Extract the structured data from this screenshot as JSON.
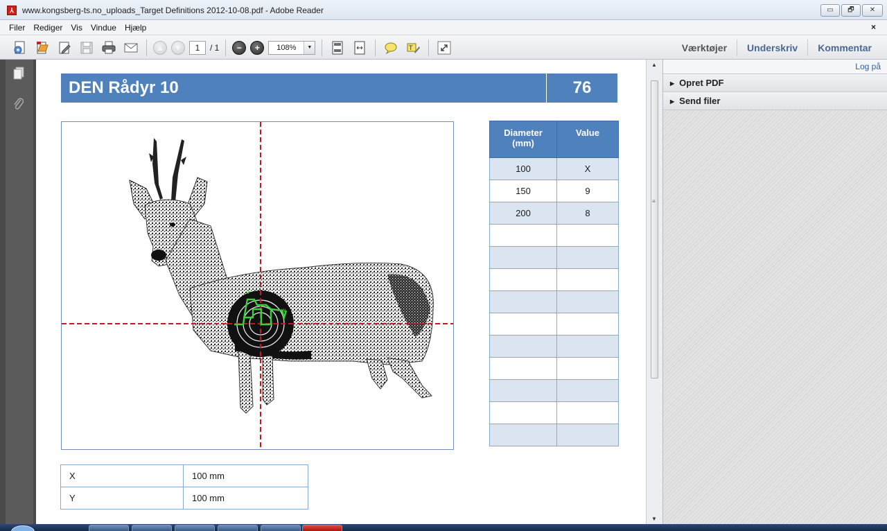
{
  "window": {
    "title": "www.kongsberg-ts.no_uploads_Target Definitions 2012-10-08.pdf - Adobe Reader",
    "buttons": [
      "▭",
      "🗗",
      "✕"
    ]
  },
  "menu": {
    "items": [
      "Filer",
      "Rediger",
      "Vis",
      "Vindue",
      "Hjælp"
    ],
    "close_doc": "×"
  },
  "toolbar": {
    "page_current": "1",
    "page_total": "/ 1",
    "zoom": "108%",
    "zoom_dropdown": "▼",
    "zoom_out": "−",
    "zoom_in": "+",
    "right_links": [
      "Værktøjer",
      "Underskriv",
      "Kommentar"
    ]
  },
  "document": {
    "title": "DEN Rådyr 10",
    "number": "76",
    "value_table": {
      "headers": [
        "Diameter (mm)",
        "Value"
      ],
      "rows": [
        [
          "100",
          "X"
        ],
        [
          "150",
          "9"
        ],
        [
          "200",
          "8"
        ],
        [
          "",
          ""
        ],
        [
          "",
          ""
        ],
        [
          "",
          ""
        ],
        [
          "",
          ""
        ],
        [
          "",
          ""
        ],
        [
          "",
          ""
        ],
        [
          "",
          ""
        ],
        [
          "",
          ""
        ],
        [
          "",
          ""
        ],
        [
          "",
          ""
        ]
      ]
    },
    "xy_table": [
      [
        "X",
        "100 mm"
      ],
      [
        "Y",
        "100 mm"
      ]
    ],
    "target": {
      "diameters_mm": [
        100,
        150,
        200
      ],
      "bullseye_color": "#111111",
      "crosshair_color": "#c0191f",
      "marker_color": "#38d13a"
    }
  },
  "rightpane": {
    "login": "Log på",
    "sections": [
      "Opret PDF",
      "Send filer"
    ]
  },
  "colors": {
    "banner": "#4f81bd",
    "table_alt": "#dbe5f1",
    "link": "#4a6790"
  }
}
